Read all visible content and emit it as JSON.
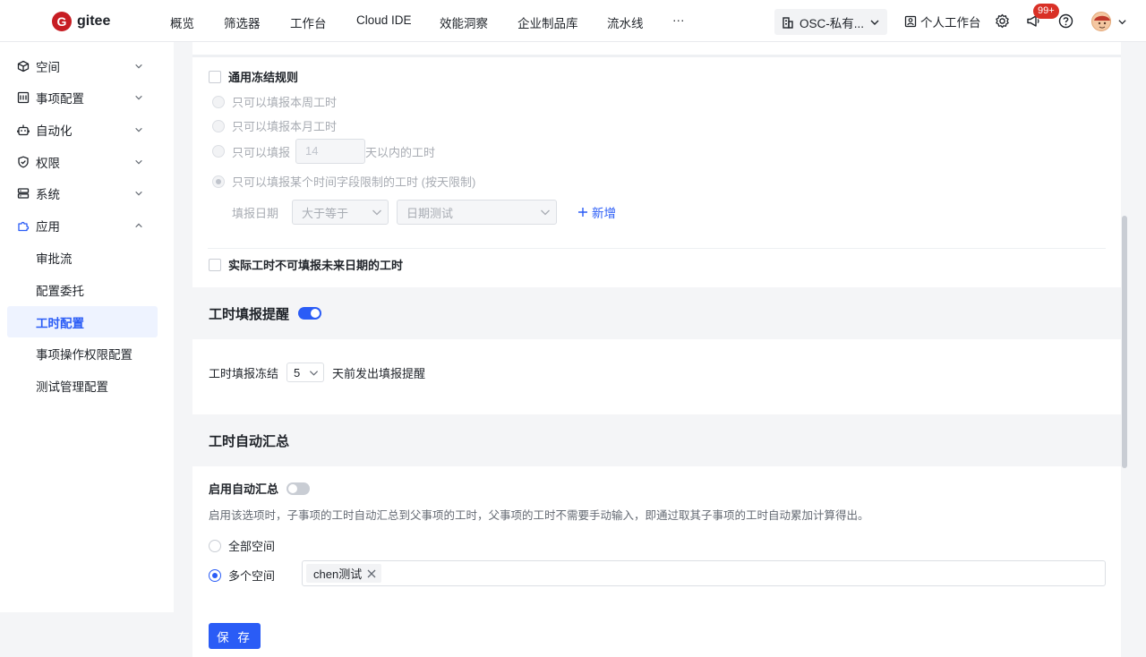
{
  "brand": {
    "name": "gitee"
  },
  "nav": {
    "items": [
      "概览",
      "筛选器",
      "工作台",
      "Cloud IDE",
      "效能洞察",
      "企业制品库",
      "流水线",
      "···"
    ],
    "org": "OSC-私有...",
    "personal": "个人工作台",
    "badge": "99+"
  },
  "sidebar": {
    "groups": [
      {
        "label": "空间",
        "icon": "cube-icon"
      },
      {
        "label": "事项配置",
        "icon": "list-icon"
      },
      {
        "label": "自动化",
        "icon": "robot-icon"
      },
      {
        "label": "权限",
        "icon": "shield-icon"
      },
      {
        "label": "系统",
        "icon": "server-icon"
      },
      {
        "label": "应用",
        "icon": "puzzle-icon"
      }
    ],
    "sub_items": [
      "审批流",
      "配置委托",
      "工时配置",
      "事项操作权限配置",
      "测试管理配置"
    ],
    "selected": "工时配置"
  },
  "freeze": {
    "general_rule_label": "通用冻结规则",
    "opt_week": "只可以填报本周工时",
    "opt_month": "只可以填报本月工时",
    "opt_days_prefix": "只可以填报",
    "opt_days_value": "14",
    "opt_days_suffix": "天以内的工时",
    "opt_field": "只可以填报某个时间字段限制的工时 (按天限制)",
    "date_label": "填报日期",
    "operator": "大于等于",
    "field": "日期测试",
    "add_label": "新增",
    "future_label": "实际工时不可填报未来日期的工时"
  },
  "reminder": {
    "title": "工时填报提醒",
    "enabled": true,
    "prefix": "工时填报冻结",
    "days": "5",
    "suffix": "天前发出填报提醒"
  },
  "auto_sum": {
    "title": "工时自动汇总",
    "enable_label": "启用自动汇总",
    "enabled": false,
    "description": "启用该选项时，子事项的工时自动汇总到父事项的工时，父事项的工时不需要手动输入，即通过取其子事项的工时自动累加计算得出。",
    "scope_all": "全部空间",
    "scope_multi": "多个空间",
    "selected_scope": "多个空间",
    "spaces": [
      "chen测试"
    ]
  },
  "actions": {
    "save": "保 存"
  },
  "colors": {
    "primary": "#2a5cf6",
    "brand": "#c71d23"
  }
}
